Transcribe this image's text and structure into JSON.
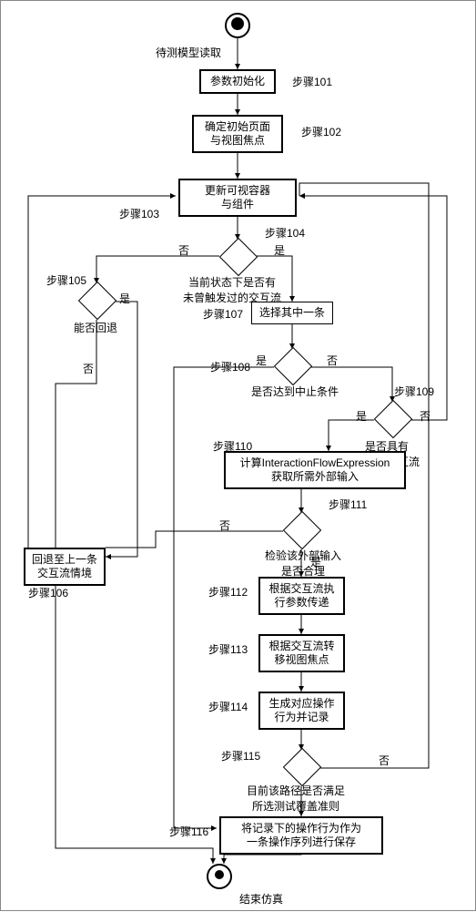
{
  "start_label": "待测模型读取",
  "end_label": "结束仿真",
  "steps": {
    "s101": {
      "label": "步骤101",
      "text": "参数初始化"
    },
    "s102": {
      "label": "步骤102",
      "text": "确定初始页面\n与视图焦点"
    },
    "s103": {
      "label": "步骤103",
      "text": "更新可视容器\n与组件"
    },
    "s104": {
      "label": "步骤104",
      "text": "当前状态下是否有\n未曾触发过的交互流"
    },
    "s105": {
      "label": "步骤105",
      "text": "能否回退"
    },
    "s106": {
      "label": "步骤106",
      "text": "回退至上一条\n交互流情境"
    },
    "s107": {
      "label": "步骤107",
      "text": "选择其中一条"
    },
    "s108": {
      "label": "步骤108",
      "text": "是否达到中止条件"
    },
    "s109": {
      "label": "步骤109",
      "text": "是否具有\n兄弟交互流"
    },
    "s110": {
      "label": "步骤110",
      "text": "计算InteractionFlowExpression\n获取所需外部输入"
    },
    "s111": {
      "label": "步骤111",
      "text": "检验该外部输入\n是否合理"
    },
    "s112": {
      "label": "步骤112",
      "text": "根据交互流执\n行参数传递"
    },
    "s113": {
      "label": "步骤113",
      "text": "根据交互流转\n移视图焦点"
    },
    "s114": {
      "label": "步骤114",
      "text": "生成对应操作\n行为并记录"
    },
    "s115": {
      "label": "步骤115",
      "text": "目前该路径是否满足\n所选测试覆盖准则"
    },
    "s116": {
      "label": "步骤116",
      "text": "将记录下的操作行为作为\n一条操作序列进行保存"
    }
  },
  "branches": {
    "yes": "是",
    "no": "否"
  }
}
